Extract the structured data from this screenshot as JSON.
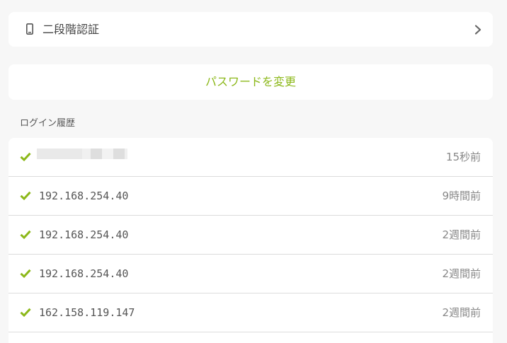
{
  "security": {
    "two_factor_label": "二段階認証",
    "change_password_label": "パスワードを変更"
  },
  "login_history": {
    "title": "ログイン履歴",
    "rows": [
      {
        "ip": "",
        "time": "15秒前",
        "status": "success",
        "ip_obscured": true
      },
      {
        "ip": "192.168.254.40",
        "time": "9時間前",
        "status": "success"
      },
      {
        "ip": "192.168.254.40",
        "time": "2週間前",
        "status": "success"
      },
      {
        "ip": "192.168.254.40",
        "time": "2週間前",
        "status": "success"
      },
      {
        "ip": "162.158.119.147",
        "time": "2週間前",
        "status": "success"
      }
    ]
  },
  "icons": {
    "two_factor": "mobile-phone-icon",
    "navigate": "chevron-right-icon",
    "login_success": "check-icon"
  },
  "colors": {
    "accent": "#8cb81a",
    "background": "#f7f7f7",
    "card": "#ffffff",
    "divider": "#dcdcdc"
  }
}
